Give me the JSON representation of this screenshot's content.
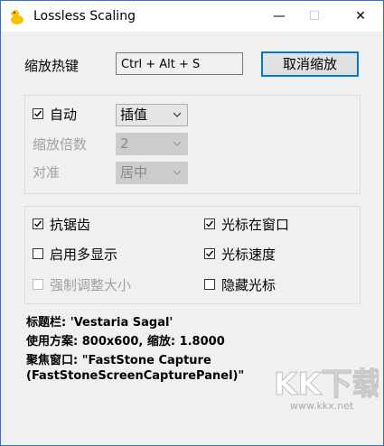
{
  "window": {
    "title": "Lossless Scaling",
    "app_icon": "rubber-duck-icon",
    "minimize_glyph": "—",
    "maximize_glyph": "☐",
    "close_glyph": "✕"
  },
  "hotkey": {
    "label": "缩放热键",
    "value": "Ctrl + Alt + S",
    "cancel_button": "取消缩放"
  },
  "scaling_group": {
    "auto_label": "自动",
    "auto_checked": true,
    "mode_value": "插值",
    "factor_label": "缩放倍数",
    "factor_value": "2",
    "align_label": "对准",
    "align_value": "居中"
  },
  "options": {
    "antialias": {
      "label": "抗锯齿",
      "checked": true
    },
    "multi_display": {
      "label": "启用多显示",
      "checked": false
    },
    "force_resize": {
      "label": "强制调整大小",
      "checked": false,
      "disabled": true
    },
    "cursor_in_window": {
      "label": "光标在窗口",
      "checked": true
    },
    "cursor_speed": {
      "label": "光标速度",
      "checked": true
    },
    "hide_cursor": {
      "label": "隐藏光标",
      "checked": false
    }
  },
  "info": {
    "line1": "标题栏: 'Vestaria Sagal'",
    "line2": "使用方案: 800x600, 缩放: 1.8000",
    "line3": "聚焦窗口: \"FastStone Capture",
    "line4": "(FastStoneScreenCapturePanel)\""
  },
  "watermark": {
    "logo": "KK下载",
    "url": "www.kkx.net"
  },
  "colors": {
    "accent": "#0078d7",
    "window_border": "#2b6fd6",
    "client_bg": "#f0f0f0",
    "disabled_text": "#a0a0a0"
  }
}
